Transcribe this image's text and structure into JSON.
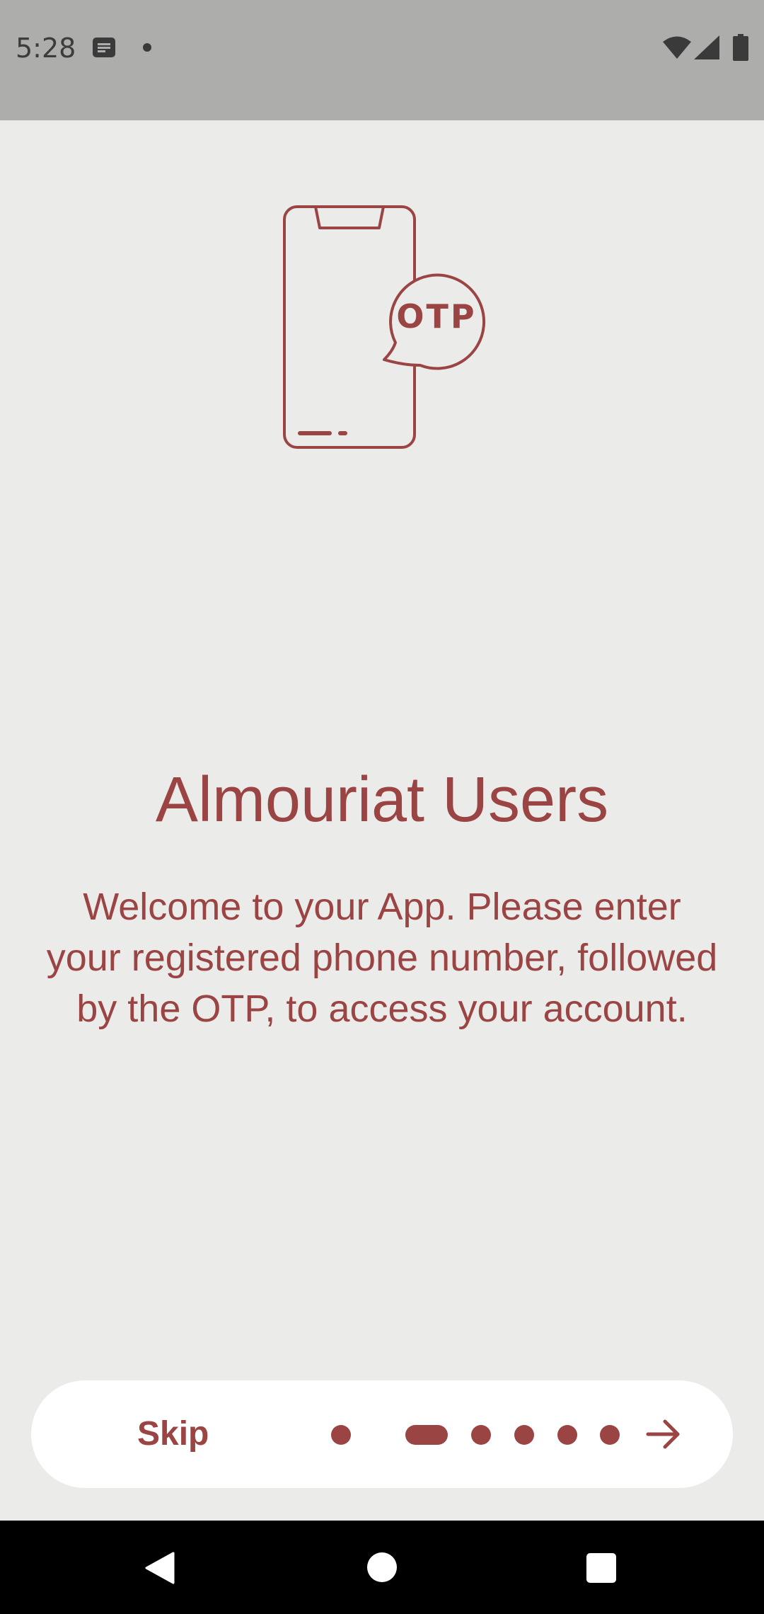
{
  "status_bar": {
    "time": "5:28",
    "icons": [
      "notification-icon",
      "dot-icon",
      "wifi-icon",
      "signal-icon",
      "battery-icon"
    ]
  },
  "illustration": {
    "icon": "phone-otp-icon",
    "bubble_text": "OTP"
  },
  "onboarding": {
    "title": "Almouriat Users",
    "description": "Welcome to your App. Please enter your registered phone number, followed by the OTP, to access your account."
  },
  "bottom_bar": {
    "skip_label": "Skip",
    "page_count": 6,
    "active_page": 2,
    "next_icon": "arrow-right-icon"
  },
  "navigation_bar": {
    "icons": [
      "back-icon",
      "home-icon",
      "recents-icon"
    ]
  },
  "colors": {
    "accent": "#9b4444",
    "background": "#ebebe9",
    "status_bar": "#adadac",
    "nav_bar": "#000000"
  }
}
